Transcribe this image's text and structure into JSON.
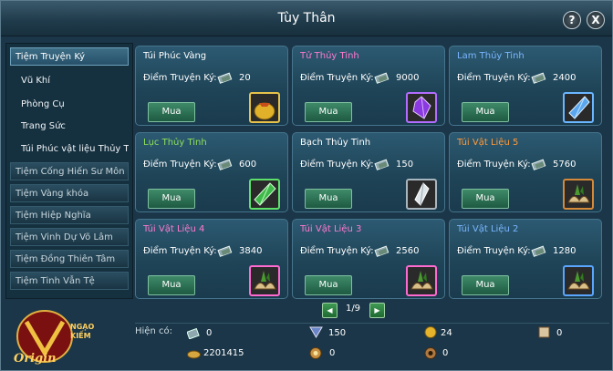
{
  "window": {
    "title": "Tùy Thân",
    "help": "?",
    "close": "X"
  },
  "sidebar": {
    "items": [
      {
        "label": "Tiệm Truyện Ký",
        "kind": "cat",
        "active": true
      },
      {
        "label": "Vũ Khí",
        "kind": "sub"
      },
      {
        "label": "Phòng Cụ",
        "kind": "sub"
      },
      {
        "label": "Trang Sức",
        "kind": "sub"
      },
      {
        "label": "Túi Phúc vật liệu Thủy Tin",
        "kind": "sub"
      },
      {
        "label": "Tiệm Cống Hiến Sư Môn",
        "kind": "cat"
      },
      {
        "label": "Tiệm Vàng khóa",
        "kind": "cat"
      },
      {
        "label": "Tiệm Hiệp Nghĩa",
        "kind": "cat"
      },
      {
        "label": "Tiệm Vinh Dự Võ Lâm",
        "kind": "cat"
      },
      {
        "label": "Tiệm Đồng Thiên Tâm",
        "kind": "cat"
      },
      {
        "label": "Tiệm Tinh Vẫn Tệ",
        "kind": "cat"
      }
    ]
  },
  "logo": {
    "text": "Ngạo Kiếm Origin"
  },
  "shop": {
    "price_label": "Điểm Truyện Ký:",
    "buy_label": "Mua",
    "items": [
      {
        "name": "Túi Phúc Vàng",
        "color": "#ffffff",
        "price": "20",
        "icon": "gold-bag-icon"
      },
      {
        "name": "Tử Thủy Tinh",
        "color": "#ff7ad0",
        "price": "9000",
        "icon": "purple-crystal-icon"
      },
      {
        "name": "Lam Thủy Tinh",
        "color": "#7ab6ff",
        "price": "2400",
        "icon": "blue-crystal-icon"
      },
      {
        "name": "Lục Thủy Tinh",
        "color": "#8de05a",
        "price": "600",
        "icon": "green-crystal-icon"
      },
      {
        "name": "Bạch Thủy Tinh",
        "color": "#ffffff",
        "price": "150",
        "icon": "white-crystal-icon"
      },
      {
        "name": "Túi Vật Liệu 5",
        "color": "#ff9a3a",
        "price": "5760",
        "icon": "material-bag-icon"
      },
      {
        "name": "Túi Vật Liệu 4",
        "color": "#ff7ad0",
        "price": "3840",
        "icon": "material-bag-icon"
      },
      {
        "name": "Túi Vật Liệu 3",
        "color": "#ff7ad0",
        "price": "2560",
        "icon": "material-bag-icon"
      },
      {
        "name": "Túi Vật Liệu 2",
        "color": "#7ab6ff",
        "price": "1280",
        "icon": "material-bag-icon"
      }
    ]
  },
  "pager": {
    "text": "1/9",
    "prev": "◀",
    "next": "▶"
  },
  "currency": {
    "label": "Hiện có:",
    "items": [
      {
        "value": "0",
        "icon": "truyen-ky-point-icon"
      },
      {
        "value": "150",
        "icon": "honor-badge-icon"
      },
      {
        "value": "24",
        "icon": "gold-coin-icon"
      },
      {
        "value": "0",
        "icon": "scroll-icon"
      },
      {
        "value": "2201415",
        "icon": "silver-ingot-icon"
      },
      {
        "value": "0",
        "icon": "medal-icon"
      },
      {
        "value": "0",
        "icon": "bronze-coin-icon"
      }
    ]
  }
}
